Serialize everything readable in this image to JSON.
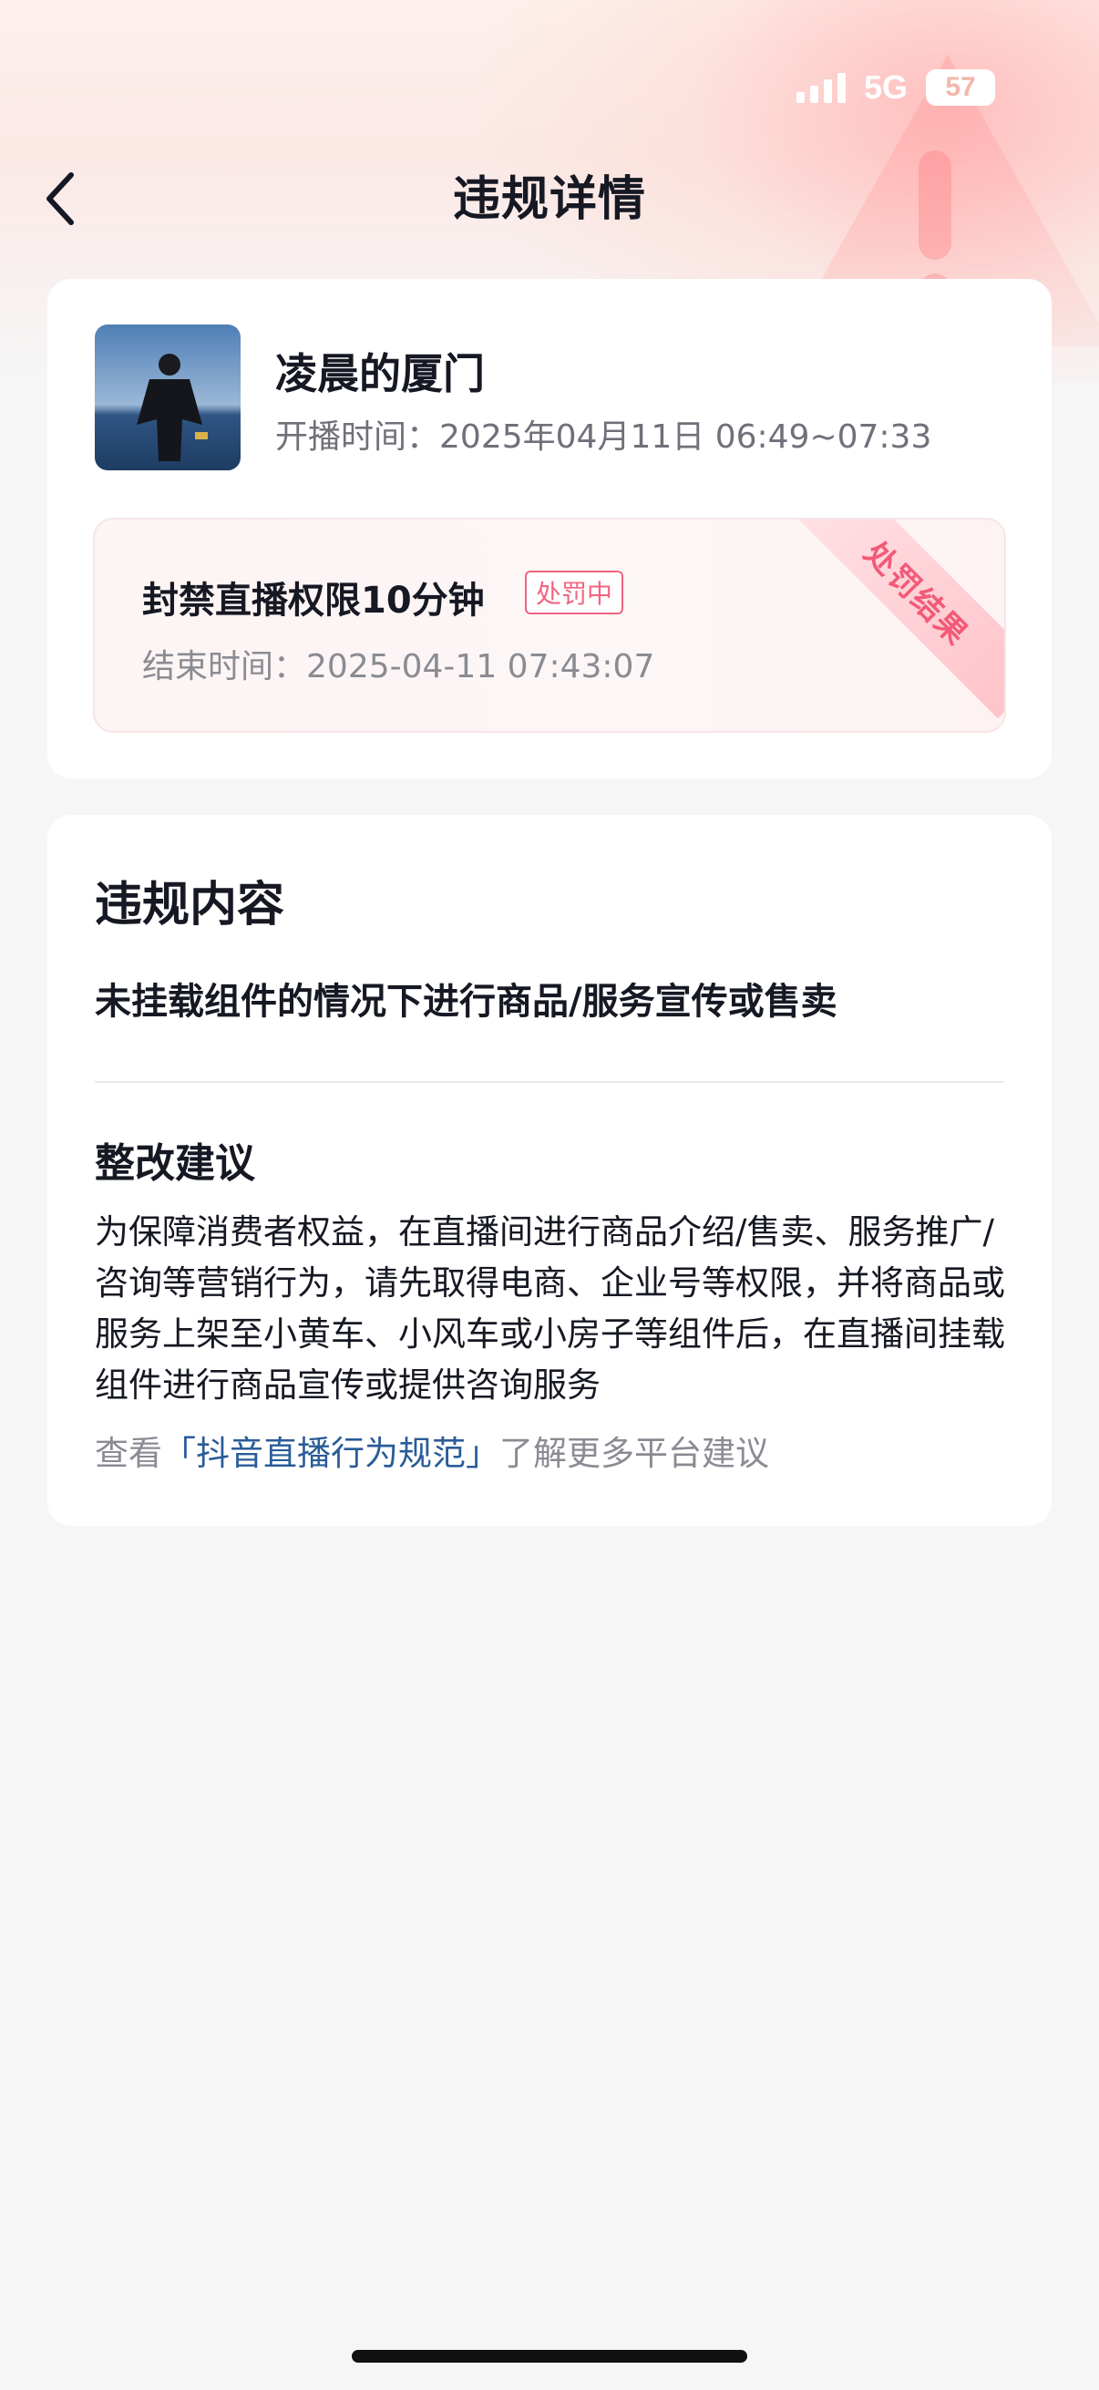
{
  "status_bar": {
    "network": "5G",
    "battery": "57"
  },
  "header": {
    "title": "违规详情"
  },
  "live_info": {
    "streamer_name": "凌晨的厦门",
    "stream_time_label": "开播时间：",
    "stream_time_value": "2025年04月11日 06:49~07:33"
  },
  "penalty": {
    "ribbon_label": "处罚结果",
    "title": "封禁直播权限10分钟",
    "status_tag": "处罚中",
    "end_time_label": "结束时间：",
    "end_time_value": "2025-04-11 07:43:07"
  },
  "violation": {
    "section_title": "违规内容",
    "description": "未挂载组件的情况下进行商品/服务宣传或售卖",
    "suggestion_title": "整改建议",
    "suggestion_text": "为保障消费者权益，在直播间进行商品介绍/售卖、服务推广/咨询等营销行为，请先取得电商、企业号等权限，并将商品或服务上架至小黄车、小风车或小房子等组件后，在直播间挂载组件进行商品宣传或提供咨询服务",
    "more_prefix": "查看",
    "more_link": "「抖音直播行为规范」",
    "more_suffix": "了解更多平台建议"
  },
  "colors": {
    "accent_red": "#f2647f",
    "link_blue": "#2a5c98",
    "text_primary": "#161823",
    "text_secondary": "#8a8b93"
  },
  "icons": {
    "back": "chevron-left-icon",
    "signal": "signal-bars-icon",
    "battery": "battery-icon"
  }
}
